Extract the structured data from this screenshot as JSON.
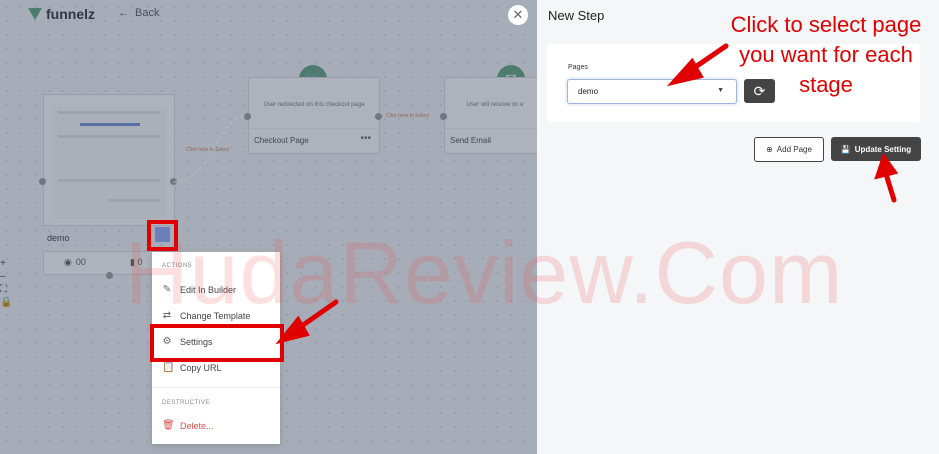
{
  "header": {
    "logo_text": "funnelz",
    "back_label": "Back",
    "back_icon": "arrow-left-icon"
  },
  "flow": {
    "page_card": {
      "label": "demo",
      "views": "00",
      "clicks": "0"
    },
    "steps": [
      {
        "description": "User redirected on this checkout page",
        "title": "Checkout Page",
        "icon": "cart-icon"
      },
      {
        "description": "User will receive on e",
        "title": "Send Email",
        "icon": "mail-icon"
      }
    ],
    "connector_hints": [
      "Click here to Select",
      "Click here to Select"
    ]
  },
  "context_menu": {
    "actions_header": "ACTIONS",
    "actions": [
      {
        "label": "Edit In Builder",
        "icon": "pencil-icon"
      },
      {
        "label": "Change Template",
        "icon": "swap-icon"
      },
      {
        "label": "Settings",
        "icon": "gear-icon"
      },
      {
        "label": "Copy URL",
        "icon": "clipboard-icon"
      }
    ],
    "destructive_header": "DESTRUCTIVE",
    "destructive": [
      {
        "label": "Delete...",
        "icon": "trash-icon",
        "color": "#d9534f"
      }
    ]
  },
  "side_panel": {
    "title": "New Step",
    "pages_label": "Pages",
    "selected_page": "demo",
    "add_page_label": "Add Page",
    "update_label": "Update Setting"
  },
  "annotation": {
    "line1": "Click to select page",
    "line2": "you want for each",
    "line3": "stage"
  },
  "watermark": "HudaReview.Com",
  "colors": {
    "accent_green": "#5aa37a",
    "annotation_red": "#e00000",
    "dark_button": "#444444"
  }
}
